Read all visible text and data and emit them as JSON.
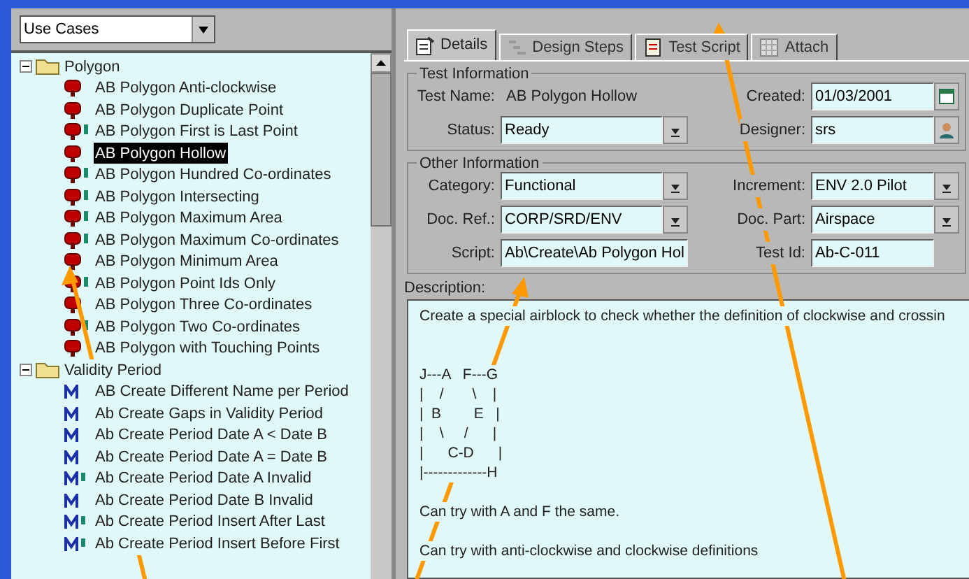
{
  "view_selector": {
    "value": "Use Cases"
  },
  "tree": [
    {
      "label": "Polygon",
      "expanded": true,
      "children": [
        {
          "label": "AB Polygon Anti-clockwise",
          "kind": "pin",
          "flagged": false,
          "selected": false
        },
        {
          "label": "AB Polygon Duplicate Point",
          "kind": "pin",
          "flagged": false,
          "selected": false
        },
        {
          "label": "AB Polygon First is Last Point",
          "kind": "pin",
          "flagged": true,
          "selected": false
        },
        {
          "label": "AB Polygon Hollow",
          "kind": "pin",
          "flagged": false,
          "selected": true
        },
        {
          "label": "AB Polygon Hundred Co-ordinates",
          "kind": "pin",
          "flagged": true,
          "selected": false
        },
        {
          "label": "AB Polygon Intersecting",
          "kind": "pin",
          "flagged": true,
          "selected": false
        },
        {
          "label": "AB Polygon Maximum Area",
          "kind": "pin",
          "flagged": true,
          "selected": false
        },
        {
          "label": "AB Polygon Maximum Co-ordinates",
          "kind": "pin",
          "flagged": true,
          "selected": false
        },
        {
          "label": "AB Polygon Minimum Area",
          "kind": "pin",
          "flagged": false,
          "selected": false
        },
        {
          "label": "AB Polygon Point Ids Only",
          "kind": "pin",
          "flagged": true,
          "selected": false
        },
        {
          "label": "AB Polygon Three Co-ordinates",
          "kind": "pin",
          "flagged": false,
          "selected": false
        },
        {
          "label": "AB Polygon Two Co-ordinates",
          "kind": "pin",
          "flagged": true,
          "selected": false
        },
        {
          "label": "AB Polygon with Touching Points",
          "kind": "pin",
          "flagged": false,
          "selected": false
        }
      ]
    },
    {
      "label": "Validity Period",
      "expanded": true,
      "children": [
        {
          "label": "AB Create Different Name per Period",
          "kind": "manual",
          "flagged": false,
          "selected": false
        },
        {
          "label": "Ab Create Gaps in Validity Period",
          "kind": "manual",
          "flagged": false,
          "selected": false
        },
        {
          "label": "Ab Create Period Date A < Date B",
          "kind": "manual",
          "flagged": false,
          "selected": false
        },
        {
          "label": "Ab Create Period Date A = Date B",
          "kind": "manual",
          "flagged": false,
          "selected": false
        },
        {
          "label": "Ab Create Period Date A Invalid",
          "kind": "manual",
          "flagged": true,
          "selected": false
        },
        {
          "label": "Ab Create Period Date B Invalid",
          "kind": "manual",
          "flagged": false,
          "selected": false
        },
        {
          "label": "Ab Create Period Insert After Last",
          "kind": "manual",
          "flagged": true,
          "selected": false
        },
        {
          "label": "Ab Create Period Insert Before First",
          "kind": "manual",
          "flagged": true,
          "selected": false
        }
      ]
    }
  ],
  "tabs": [
    {
      "label": "Details",
      "selected": true
    },
    {
      "label": "Design Steps",
      "selected": false
    },
    {
      "label": "Test Script",
      "selected": false
    },
    {
      "label": "Attach",
      "selected": false
    }
  ],
  "groups": [
    {
      "title": "Test Information",
      "rows": [
        [
          {
            "label": "Test Name:",
            "value": "AB Polygon Hollow",
            "kind": "plain"
          },
          {
            "label": "Created:",
            "value": "01/03/2001",
            "kind": "date"
          }
        ],
        [
          {
            "label": "Status:",
            "value": "Ready",
            "kind": "dropdown"
          },
          {
            "label": "Designer:",
            "value": "srs",
            "kind": "person"
          }
        ]
      ]
    },
    {
      "title": "Other Information",
      "rows": [
        [
          {
            "label": "Category:",
            "value": "Functional",
            "kind": "dropdown"
          },
          {
            "label": "Increment:",
            "value": "ENV 2.0 Pilot",
            "kind": "dropdown"
          }
        ],
        [
          {
            "label": "Doc. Ref.:",
            "value": "CORP/SRD/ENV",
            "kind": "dropdown"
          },
          {
            "label": "Doc. Part:",
            "value": "Airspace",
            "kind": "dropdown"
          }
        ],
        [
          {
            "label": "Script:",
            "value": "Ab\\Create\\Ab Polygon Hol",
            "kind": "text"
          },
          {
            "label": "Test Id:",
            "value": "Ab-C-011",
            "kind": "text"
          }
        ]
      ]
    }
  ],
  "description": {
    "label": "Description:",
    "paragraphs": [
      [
        "Create a special airblock to check whether the definition of clockwise and crossin"
      ],
      [
        "J---A   F---G",
        "|    /       \\    |",
        "|  B        E   |",
        "|    \\     /      |",
        "|      C-D      |",
        "|-------------H"
      ],
      [
        "Can try with A and F the same."
      ],
      [
        "Can try with anti-clockwise and clockwise definitions"
      ]
    ]
  }
}
